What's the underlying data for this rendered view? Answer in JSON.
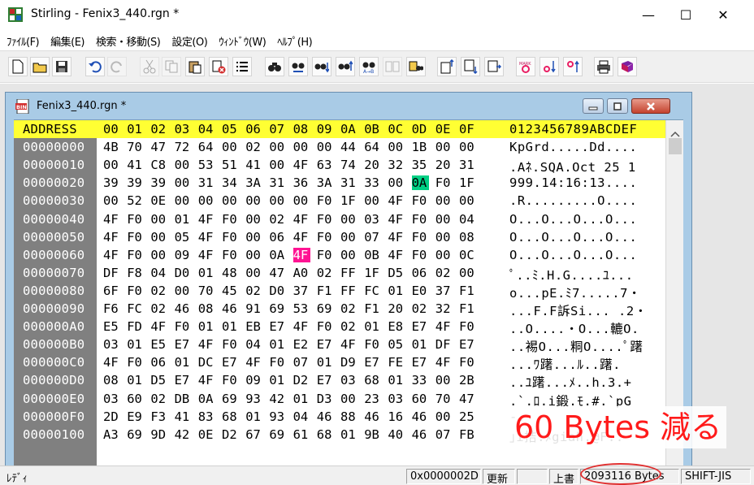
{
  "window": {
    "title": "Stirling - Fenix3_440.rgn *",
    "minimize": "—",
    "maximize": "☐",
    "close": "✕"
  },
  "menu": {
    "items": [
      "ﾌｧｲﾙ(F)",
      "編集(E)",
      "検索・移動(S)",
      "設定(O)",
      "ｳｨﾝﾄﾞｳ(W)",
      "ﾍﾙﾌﾟ(H)"
    ]
  },
  "toolbar": {
    "buttons": [
      {
        "name": "new-file-icon"
      },
      {
        "name": "open-folder-icon"
      },
      {
        "name": "save-icon"
      },
      {
        "name": "undo-icon"
      },
      {
        "name": "redo-icon"
      },
      {
        "name": "cut-icon"
      },
      {
        "name": "copy-icon"
      },
      {
        "name": "paste-icon"
      },
      {
        "name": "delete-icon"
      },
      {
        "name": "list-icon"
      },
      {
        "name": "find-icon"
      },
      {
        "name": "find-replace-icon"
      },
      {
        "name": "find-next-icon"
      },
      {
        "name": "find-prev-icon"
      },
      {
        "name": "find-ab-icon"
      },
      {
        "name": "compare-icon"
      },
      {
        "name": "jump-icon"
      },
      {
        "name": "block-start-icon"
      },
      {
        "name": "block-end-icon"
      },
      {
        "name": "block-icon"
      },
      {
        "name": "mark-icon"
      },
      {
        "name": "mark-next-icon"
      },
      {
        "name": "mark-prev-icon"
      },
      {
        "name": "print-icon"
      },
      {
        "name": "help-book-icon"
      }
    ]
  },
  "document": {
    "title": "Fenix3_440.rgn *",
    "header": {
      "address": "ADDRESS",
      "cols": [
        "00",
        "01",
        "02",
        "03",
        "04",
        "05",
        "06",
        "07",
        "08",
        "09",
        "0A",
        "0B",
        "0C",
        "0D",
        "0E",
        "0F"
      ],
      "ascii": "0123456789ABCDEF"
    },
    "rows": [
      {
        "addr": "00000000",
        "bytes": [
          "4B",
          "70",
          "47",
          "72",
          "64",
          "00",
          "02",
          "00",
          "00",
          "00",
          "44",
          "64",
          "00",
          "1B",
          "00",
          "00"
        ],
        "ascii": "KpGrd.....Dd...."
      },
      {
        "addr": "00000010",
        "bytes": [
          "00",
          "41",
          "C8",
          "00",
          "53",
          "51",
          "41",
          "00",
          "4F",
          "63",
          "74",
          "20",
          "32",
          "35",
          "20",
          "31"
        ],
        "ascii": ".Aﾈ.SQA.Oct 25 1"
      },
      {
        "addr": "00000020",
        "bytes": [
          "39",
          "39",
          "39",
          "00",
          "31",
          "34",
          "3A",
          "31",
          "36",
          "3A",
          "31",
          "33",
          "00",
          "0A",
          "F0",
          "1F"
        ],
        "ascii": "999.14:16:13...."
      },
      {
        "addr": "00000030",
        "bytes": [
          "00",
          "52",
          "0E",
          "00",
          "00",
          "00",
          "00",
          "00",
          "00",
          "F0",
          "1F",
          "00",
          "4F",
          "F0",
          "00",
          "00"
        ],
        "ascii": ".R.........O...."
      },
      {
        "addr": "00000040",
        "bytes": [
          "4F",
          "F0",
          "00",
          "01",
          "4F",
          "F0",
          "00",
          "02",
          "4F",
          "F0",
          "00",
          "03",
          "4F",
          "F0",
          "00",
          "04"
        ],
        "ascii": "O...O...O...O..."
      },
      {
        "addr": "00000050",
        "bytes": [
          "4F",
          "F0",
          "00",
          "05",
          "4F",
          "F0",
          "00",
          "06",
          "4F",
          "F0",
          "00",
          "07",
          "4F",
          "F0",
          "00",
          "08"
        ],
        "ascii": "O...O...O...O..."
      },
      {
        "addr": "00000060",
        "bytes": [
          "4F",
          "F0",
          "00",
          "09",
          "4F",
          "F0",
          "00",
          "0A",
          "4F",
          "F0",
          "00",
          "0B",
          "4F",
          "F0",
          "00",
          "0C"
        ],
        "ascii": "O...O...O...O..."
      },
      {
        "addr": "00000070",
        "bytes": [
          "DF",
          "F8",
          "04",
          "D0",
          "01",
          "48",
          "00",
          "47",
          "A0",
          "02",
          "FF",
          "1F",
          "D5",
          "06",
          "02",
          "00"
        ],
        "ascii": "ﾟ..ﾐ.H.G....ﾕ..."
      },
      {
        "addr": "00000080",
        "bytes": [
          "6F",
          "F0",
          "02",
          "00",
          "70",
          "45",
          "02",
          "D0",
          "37",
          "F1",
          "FF",
          "FC",
          "01",
          "E0",
          "37",
          "F1"
        ],
        "ascii": "o...pE.ﾐ7.....7・"
      },
      {
        "addr": "00000090",
        "bytes": [
          "F6",
          "FC",
          "02",
          "46",
          "08",
          "46",
          "91",
          "69",
          "53",
          "69",
          "02",
          "F1",
          "20",
          "02",
          "32",
          "F1"
        ],
        "ascii": "...F.F訴Si... .2・"
      },
      {
        "addr": "000000A0",
        "bytes": [
          "E5",
          "FD",
          "4F",
          "F0",
          "01",
          "01",
          "EB",
          "E7",
          "4F",
          "F0",
          "02",
          "01",
          "E8",
          "E7",
          "4F",
          "F0"
        ],
        "ascii": "..O....・O...轆O."
      },
      {
        "addr": "000000B0",
        "bytes": [
          "03",
          "01",
          "E5",
          "E7",
          "4F",
          "F0",
          "04",
          "01",
          "E2",
          "E7",
          "4F",
          "F0",
          "05",
          "01",
          "DF",
          "E7"
        ],
        "ascii": "..裼O...粡O....ﾟ躇"
      },
      {
        "addr": "000000C0",
        "bytes": [
          "4F",
          "F0",
          "06",
          "01",
          "DC",
          "E7",
          "4F",
          "F0",
          "07",
          "01",
          "D9",
          "E7",
          "FE",
          "E7",
          "4F",
          "F0"
        ],
        "ascii": "...ﾜ躇...ﾙ..躇."
      },
      {
        "addr": "000000D0",
        "bytes": [
          "08",
          "01",
          "D5",
          "E7",
          "4F",
          "F0",
          "09",
          "01",
          "D2",
          "E7",
          "03",
          "68",
          "01",
          "33",
          "00",
          "2B"
        ],
        "ascii": "..ﾕ躇...ﾒ..h.3.+"
      },
      {
        "addr": "000000E0",
        "bytes": [
          "03",
          "60",
          "02",
          "DB",
          "0A",
          "69",
          "93",
          "42",
          "01",
          "D3",
          "00",
          "23",
          "03",
          "60",
          "70",
          "47"
        ],
        "ascii": ".`.ﾛ.i鍛.ﾓ.#.`pG"
      },
      {
        "addr": "000000F0",
        "bytes": [
          "2D",
          "E9",
          "F3",
          "41",
          "83",
          "68",
          "01",
          "93",
          "04",
          "46",
          "88",
          "46",
          "16",
          "46",
          "00",
          "25"
        ],
        "ascii": "-."
      },
      {
        "addr": "00000100",
        "bytes": [
          "A3",
          "69",
          "9D",
          "42",
          "0E",
          "D2",
          "67",
          "69",
          "61",
          "68",
          "01",
          "9B",
          "40",
          "46",
          "07",
          "FB"
        ],
        "ascii": "｣i拮.ﾒgiah.@F.."
      }
    ],
    "highlight_green": "0A",
    "highlight_pink": "4F"
  },
  "annotation": "60 Bytes 減る",
  "status": {
    "ready": "ﾚﾃﾞｨ",
    "offset": "0x0000002D",
    "mode": "更新",
    "blank": "",
    "overwrite": "上書",
    "size": "2093116 Bytes",
    "encoding": "SHIFT-JIS"
  }
}
